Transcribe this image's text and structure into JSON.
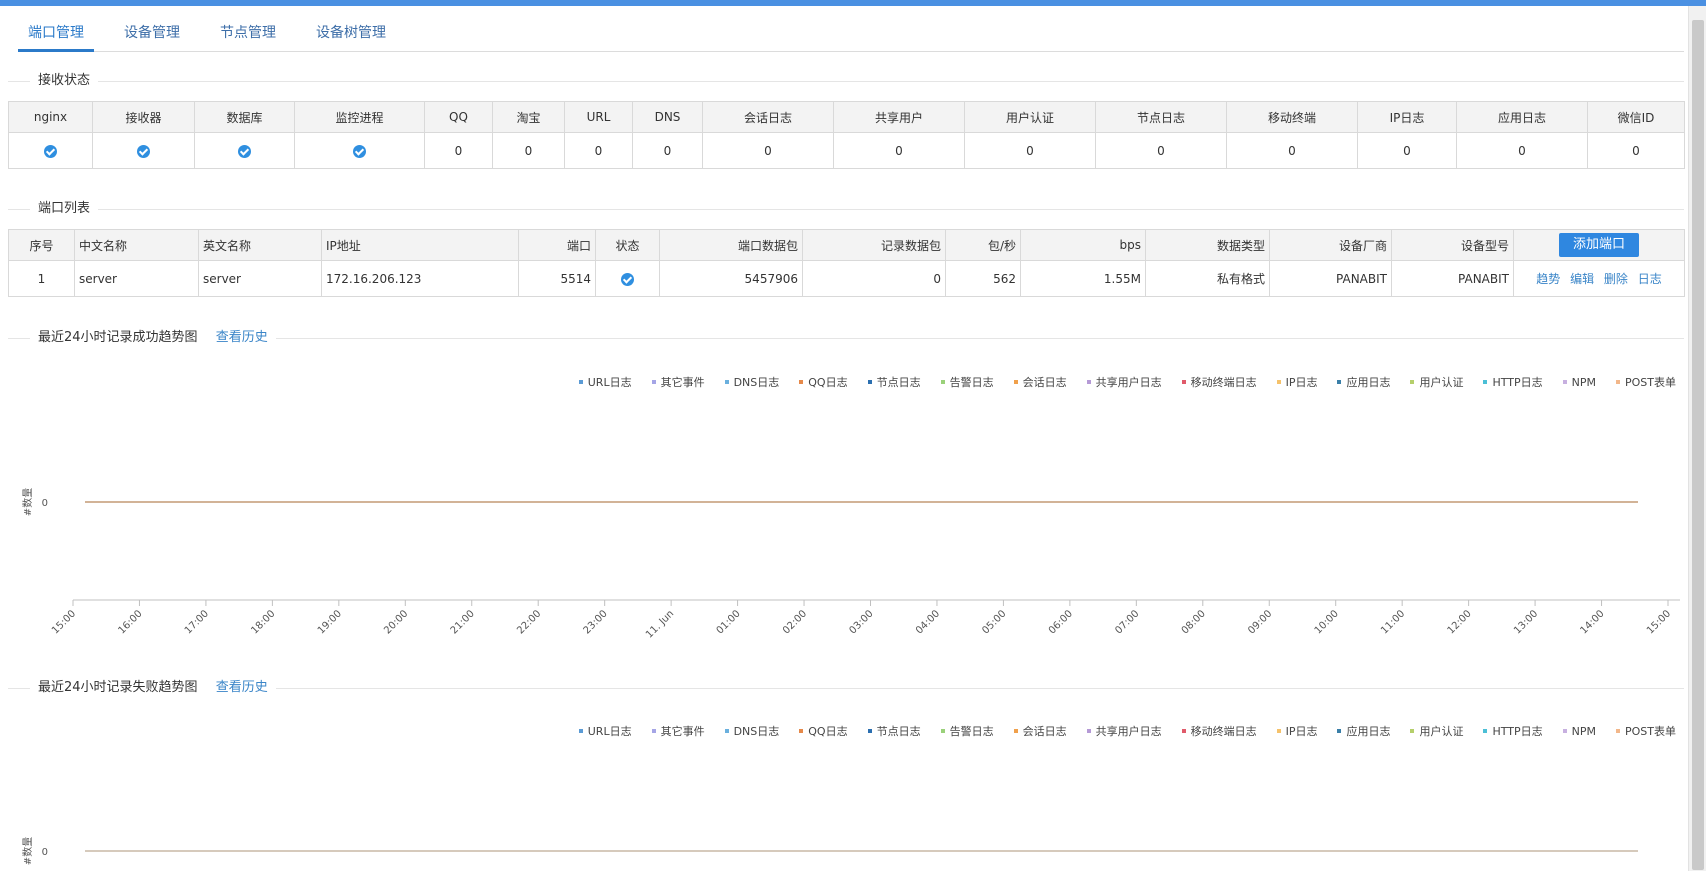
{
  "tabs": [
    "端口管理",
    "设备管理",
    "节点管理",
    "设备树管理"
  ],
  "recv_status": {
    "title": "接收状态",
    "headers": [
      "nginx",
      "接收器",
      "数据库",
      "监控进程",
      "QQ",
      "淘宝",
      "URL",
      "DNS",
      "会话日志",
      "共享用户",
      "用户认证",
      "节点日志",
      "移动终端",
      "IP日志",
      "应用日志",
      "微信ID"
    ],
    "values": [
      "0",
      "0",
      "0",
      "0",
      "0",
      "0",
      "0",
      "0",
      "0",
      "0",
      "0",
      "0"
    ]
  },
  "port_list": {
    "title": "端口列表",
    "headers": [
      "序号",
      "中文名称",
      "英文名称",
      "IP地址",
      "端口",
      "状态",
      "端口数据包",
      "记录数据包",
      "包/秒",
      "bps",
      "数据类型",
      "设备厂商",
      "设备型号"
    ],
    "add_button": "添加端口",
    "row": {
      "index": "1",
      "cn_name": "server",
      "en_name": "server",
      "ip": "172.16.206.123",
      "port": "5514",
      "port_packets": "5457906",
      "record_packets": "0",
      "pps": "562",
      "bps": "1.55M",
      "data_type": "私有格式",
      "vendor": "PANABIT",
      "model": "PANABIT",
      "ops": [
        "趋势",
        "编辑",
        "删除",
        "日志"
      ]
    }
  },
  "history_link": "查看历史",
  "chart_data": [
    {
      "type": "line",
      "title": "最近24小时记录成功趋势图",
      "ylabel": "#数量",
      "x": [
        "15:00",
        "16:00",
        "17:00",
        "18:00",
        "19:00",
        "20:00",
        "21:00",
        "22:00",
        "23:00",
        "11. Jun",
        "01:00",
        "02:00",
        "03:00",
        "04:00",
        "05:00",
        "06:00",
        "07:00",
        "08:00",
        "09:00",
        "10:00",
        "11:00",
        "12:00",
        "13:00",
        "14:00",
        "15:00"
      ],
      "yticks": [
        "0"
      ],
      "series": [
        {
          "name": "URL日志",
          "color": "#5b9bd5",
          "values": [
            0,
            0,
            0,
            0,
            0,
            0,
            0,
            0,
            0,
            0,
            0,
            0,
            0,
            0,
            0,
            0,
            0,
            0,
            0,
            0,
            0,
            0,
            0,
            0,
            0
          ]
        },
        {
          "name": "其它事件",
          "color": "#a5a5e6",
          "values": [
            0,
            0,
            0,
            0,
            0,
            0,
            0,
            0,
            0,
            0,
            0,
            0,
            0,
            0,
            0,
            0,
            0,
            0,
            0,
            0,
            0,
            0,
            0,
            0,
            0
          ]
        },
        {
          "name": "DNS日志",
          "color": "#6ab0de",
          "values": [
            0,
            0,
            0,
            0,
            0,
            0,
            0,
            0,
            0,
            0,
            0,
            0,
            0,
            0,
            0,
            0,
            0,
            0,
            0,
            0,
            0,
            0,
            0,
            0,
            0
          ]
        },
        {
          "name": "QQ日志",
          "color": "#e6894a",
          "values": [
            0,
            0,
            0,
            0,
            0,
            0,
            0,
            0,
            0,
            0,
            0,
            0,
            0,
            0,
            0,
            0,
            0,
            0,
            0,
            0,
            0,
            0,
            0,
            0,
            0
          ]
        },
        {
          "name": "节点日志",
          "color": "#2b6fb0",
          "values": [
            0,
            0,
            0,
            0,
            0,
            0,
            0,
            0,
            0,
            0,
            0,
            0,
            0,
            0,
            0,
            0,
            0,
            0,
            0,
            0,
            0,
            0,
            0,
            0,
            0
          ]
        },
        {
          "name": "告警日志",
          "color": "#9ad17a",
          "values": [
            0,
            0,
            0,
            0,
            0,
            0,
            0,
            0,
            0,
            0,
            0,
            0,
            0,
            0,
            0,
            0,
            0,
            0,
            0,
            0,
            0,
            0,
            0,
            0,
            0
          ]
        },
        {
          "name": "会话日志",
          "color": "#f0a04b",
          "values": [
            0,
            0,
            0,
            0,
            0,
            0,
            0,
            0,
            0,
            0,
            0,
            0,
            0,
            0,
            0,
            0,
            0,
            0,
            0,
            0,
            0,
            0,
            0,
            0,
            0
          ]
        },
        {
          "name": "共享用户日志",
          "color": "#b59ad6",
          "values": [
            0,
            0,
            0,
            0,
            0,
            0,
            0,
            0,
            0,
            0,
            0,
            0,
            0,
            0,
            0,
            0,
            0,
            0,
            0,
            0,
            0,
            0,
            0,
            0,
            0
          ]
        },
        {
          "name": "移动终端日志",
          "color": "#e05a6a",
          "values": [
            0,
            0,
            0,
            0,
            0,
            0,
            0,
            0,
            0,
            0,
            0,
            0,
            0,
            0,
            0,
            0,
            0,
            0,
            0,
            0,
            0,
            0,
            0,
            0,
            0
          ]
        },
        {
          "name": "IP日志",
          "color": "#f5c26b",
          "values": [
            0,
            0,
            0,
            0,
            0,
            0,
            0,
            0,
            0,
            0,
            0,
            0,
            0,
            0,
            0,
            0,
            0,
            0,
            0,
            0,
            0,
            0,
            0,
            0,
            0
          ]
        },
        {
          "name": "应用日志",
          "color": "#3a7fa8",
          "values": [
            0,
            0,
            0,
            0,
            0,
            0,
            0,
            0,
            0,
            0,
            0,
            0,
            0,
            0,
            0,
            0,
            0,
            0,
            0,
            0,
            0,
            0,
            0,
            0,
            0
          ]
        },
        {
          "name": "用户认证",
          "color": "#b5cf6b",
          "values": [
            0,
            0,
            0,
            0,
            0,
            0,
            0,
            0,
            0,
            0,
            0,
            0,
            0,
            0,
            0,
            0,
            0,
            0,
            0,
            0,
            0,
            0,
            0,
            0,
            0
          ]
        },
        {
          "name": "HTTP日志",
          "color": "#4bbfd6",
          "values": [
            0,
            0,
            0,
            0,
            0,
            0,
            0,
            0,
            0,
            0,
            0,
            0,
            0,
            0,
            0,
            0,
            0,
            0,
            0,
            0,
            0,
            0,
            0,
            0,
            0
          ]
        },
        {
          "name": "NPM",
          "color": "#c7b0e0",
          "values": [
            0,
            0,
            0,
            0,
            0,
            0,
            0,
            0,
            0,
            0,
            0,
            0,
            0,
            0,
            0,
            0,
            0,
            0,
            0,
            0,
            0,
            0,
            0,
            0,
            0
          ]
        },
        {
          "name": "POST表单",
          "color": "#f2b78a",
          "values": [
            0,
            0,
            0,
            0,
            0,
            0,
            0,
            0,
            0,
            0,
            0,
            0,
            0,
            0,
            0,
            0,
            0,
            0,
            0,
            0,
            0,
            0,
            0,
            0,
            0
          ]
        }
      ],
      "legend": "top-right"
    },
    {
      "type": "line",
      "title": "最近24小时记录失败趋势图",
      "ylabel": "#数量",
      "x": [],
      "yticks": [
        "0"
      ],
      "series": [
        {
          "name": "URL日志",
          "color": "#5b9bd5",
          "values": []
        },
        {
          "name": "其它事件",
          "color": "#a5a5e6",
          "values": []
        },
        {
          "name": "DNS日志",
          "color": "#6ab0de",
          "values": []
        },
        {
          "name": "QQ日志",
          "color": "#e6894a",
          "values": []
        },
        {
          "name": "节点日志",
          "color": "#2b6fb0",
          "values": []
        },
        {
          "name": "告警日志",
          "color": "#9ad17a",
          "values": []
        },
        {
          "name": "会话日志",
          "color": "#f0a04b",
          "values": []
        },
        {
          "name": "共享用户日志",
          "color": "#b59ad6",
          "values": []
        },
        {
          "name": "移动终端日志",
          "color": "#e05a6a",
          "values": []
        },
        {
          "name": "IP日志",
          "color": "#f5c26b",
          "values": []
        },
        {
          "name": "应用日志",
          "color": "#3a7fa8",
          "values": []
        },
        {
          "name": "用户认证",
          "color": "#b5cf6b",
          "values": []
        },
        {
          "name": "HTTP日志",
          "color": "#4bbfd6",
          "values": []
        },
        {
          "name": "NPM",
          "color": "#c7b0e0",
          "values": []
        },
        {
          "name": "POST表单",
          "color": "#f2b78a",
          "values": []
        }
      ],
      "legend": "top-right"
    }
  ]
}
